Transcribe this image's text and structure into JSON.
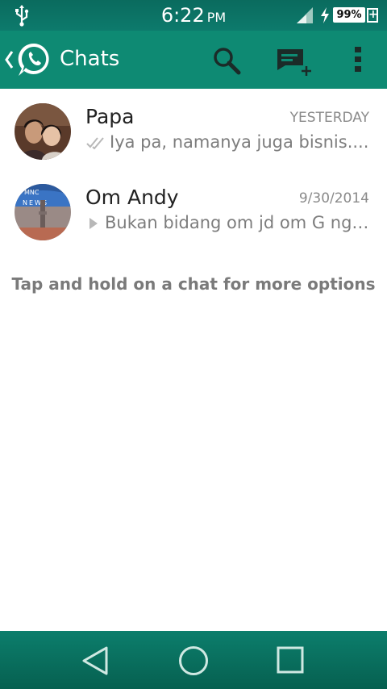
{
  "status_bar": {
    "time": "6:22",
    "ampm": "PM",
    "battery": "99%",
    "icons": [
      "usb-icon",
      "signal-icon",
      "charging-icon",
      "battery-icon"
    ]
  },
  "action_bar": {
    "title": "Chats",
    "icons": [
      "back-chevron-icon",
      "whatsapp-logo-icon",
      "search-icon",
      "new-chat-icon",
      "overflow-menu-icon"
    ],
    "color": "#0e8a73"
  },
  "chats": [
    {
      "name": "Papa",
      "time": "YESTERDAY",
      "preview": "Iya pa, namanya juga bisnis....",
      "status_icon": "read-check-icon"
    },
    {
      "name": "Om Andy",
      "time": "9/30/2014",
      "preview": "Bukan bidang om jd om G ng…",
      "status_icon": "play-icon"
    }
  ],
  "hint": "Tap and hold on a chat for more options",
  "nav_bar": {
    "icons": [
      "back-icon",
      "home-icon",
      "recent-apps-icon"
    ]
  }
}
